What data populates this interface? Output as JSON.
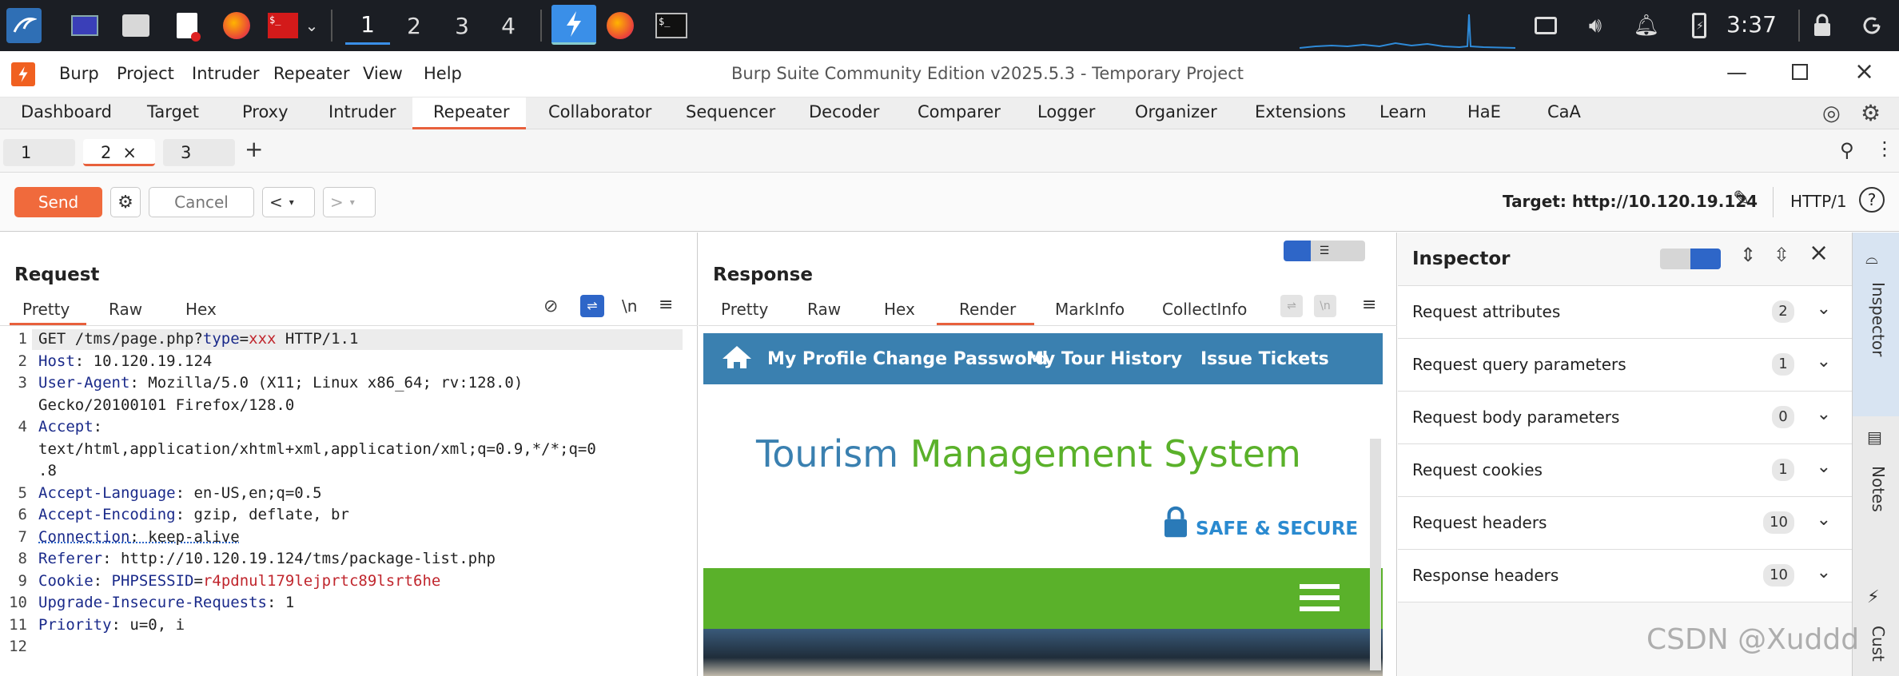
{
  "taskbar": {
    "workspaces": [
      "1",
      "2",
      "3",
      "4"
    ],
    "clock": "3:37"
  },
  "window": {
    "title": "Burp Suite Community Edition v2025.5.3 - Temporary Project",
    "menu": [
      "Burp",
      "Project",
      "Intruder",
      "Repeater",
      "View",
      "Help"
    ]
  },
  "main_tabs": [
    "Dashboard",
    "Target",
    "Proxy",
    "Intruder",
    "Repeater",
    "Collaborator",
    "Sequencer",
    "Decoder",
    "Comparer",
    "Logger",
    "Organizer",
    "Extensions",
    "Learn",
    "HaE",
    "CaA"
  ],
  "repeater_tabs": {
    "items": [
      "1",
      "2",
      "3"
    ],
    "close": "×",
    "add": "+"
  },
  "toolbar": {
    "send": "Send",
    "cancel": "Cancel",
    "back": "<",
    "fwd": ">",
    "target_label": "Target: http://10.120.19.124",
    "protocol": "HTTP/1"
  },
  "request": {
    "title": "Request",
    "tabs": [
      "Pretty",
      "Raw",
      "Hex"
    ],
    "newline_toggle": "\\n",
    "lines": [
      {
        "n": "1",
        "key": "GET /tms/page.php?",
        "param": "type",
        "eq": "=",
        "val": "xxx",
        "rest": " HTTP/1.1"
      },
      {
        "n": "2",
        "key": "Host",
        "rest": ": 10.120.19.124"
      },
      {
        "n": "3",
        "key": "User-Agent",
        "rest": ": Mozilla/5.0 (X11; Linux x86_64; rv:128.0)"
      },
      {
        "n": "",
        "key": "",
        "rest": "Gecko/20100101 Firefox/128.0"
      },
      {
        "n": "4",
        "key": "Accept",
        "rest": ":"
      },
      {
        "n": "",
        "key": "",
        "rest": "text/html,application/xhtml+xml,application/xml;q=0.9,*/*;q=0"
      },
      {
        "n": "",
        "key": "",
        "rest": ".8"
      },
      {
        "n": "5",
        "key": "Accept-Language",
        "rest": ": en-US,en;q=0.5"
      },
      {
        "n": "6",
        "key": "Accept-Encoding",
        "rest": ": gzip, deflate, br"
      },
      {
        "n": "7",
        "key": "Connection",
        "rest": ": keep-alive"
      },
      {
        "n": "8",
        "key": "Referer",
        "rest": ": http://10.120.19.124/tms/package-list.php"
      },
      {
        "n": "9",
        "key": "Cookie",
        "rest": ": ",
        "ck": "PHPSESSID",
        "ceq": "=",
        "cv": "r4pdnul179lejprtc89lsrt6he"
      },
      {
        "n": "10",
        "key": "Upgrade-Insecure-Requests",
        "rest": ": 1"
      },
      {
        "n": "11",
        "key": "Priority",
        "rest": ": u=0, i"
      },
      {
        "n": "12",
        "key": "",
        "rest": ""
      }
    ]
  },
  "response": {
    "title": "Response",
    "tabs": [
      "Pretty",
      "Raw",
      "Hex",
      "Render",
      "MarkInfo",
      "CollectInfo"
    ],
    "newline_toggle": "\\n",
    "render": {
      "nav": [
        "My Profile",
        "Change Password",
        "My Tour History",
        "Issue Tickets"
      ],
      "heading_a": "Tourism",
      "heading_b": "Management System",
      "secure": "SAFE & SECURE"
    }
  },
  "inspector": {
    "title": "Inspector",
    "rows": [
      {
        "label": "Request attributes",
        "count": "2"
      },
      {
        "label": "Request query parameters",
        "count": "1"
      },
      {
        "label": "Request body parameters",
        "count": "0"
      },
      {
        "label": "Request cookies",
        "count": "1"
      },
      {
        "label": "Request headers",
        "count": "10"
      },
      {
        "label": "Response headers",
        "count": "10"
      }
    ]
  },
  "sidebar": {
    "items": [
      "Inspector",
      "Notes",
      "Cust"
    ]
  },
  "watermark": "CSDN @Xuddd",
  "colors": {
    "accent": "#e8603c",
    "nav": "#3a80b0",
    "green": "#5ab12a"
  }
}
